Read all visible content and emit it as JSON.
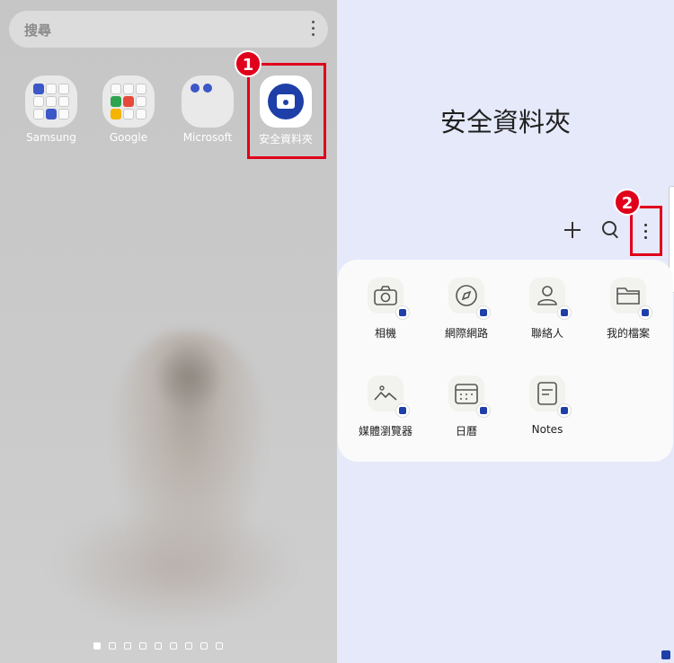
{
  "left": {
    "search_placeholder": "搜尋",
    "apps": [
      {
        "label": "Samsung"
      },
      {
        "label": "Google"
      },
      {
        "label": "Microsoft"
      },
      {
        "label": "安全資料夾"
      }
    ],
    "step1": "1",
    "page_indicator": {
      "pages": 10,
      "current": 1
    }
  },
  "right": {
    "title": "安全資料夾",
    "step2": "2",
    "apps": [
      {
        "label": "相機",
        "icon": "camera-icon"
      },
      {
        "label": "網際網路",
        "icon": "compass-icon"
      },
      {
        "label": "聯絡人",
        "icon": "person-icon"
      },
      {
        "label": "我的檔案",
        "icon": "folder-icon"
      },
      {
        "label": "媒體瀏覽器",
        "icon": "gallery-icon"
      },
      {
        "label": "日曆",
        "icon": "calendar-icon"
      },
      {
        "label": "Notes",
        "icon": "note-icon"
      }
    ]
  },
  "colors": {
    "highlight": "#e0001b",
    "brand": "#1f3fa8",
    "panel": "#e6e9fa"
  }
}
